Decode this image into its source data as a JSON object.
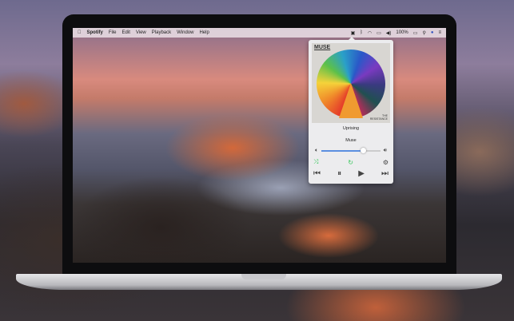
{
  "menubar": {
    "app": "Spotify",
    "items": [
      "File",
      "Edit",
      "View",
      "Playback",
      "Window",
      "Help"
    ],
    "battery": "100%"
  },
  "player": {
    "album_artist_logo": "MUSE",
    "album_title": "THE RESISTANCE",
    "track": "Uprising",
    "artist": "Muse",
    "volume_fraction": 0.7,
    "accent": "#35c759"
  }
}
